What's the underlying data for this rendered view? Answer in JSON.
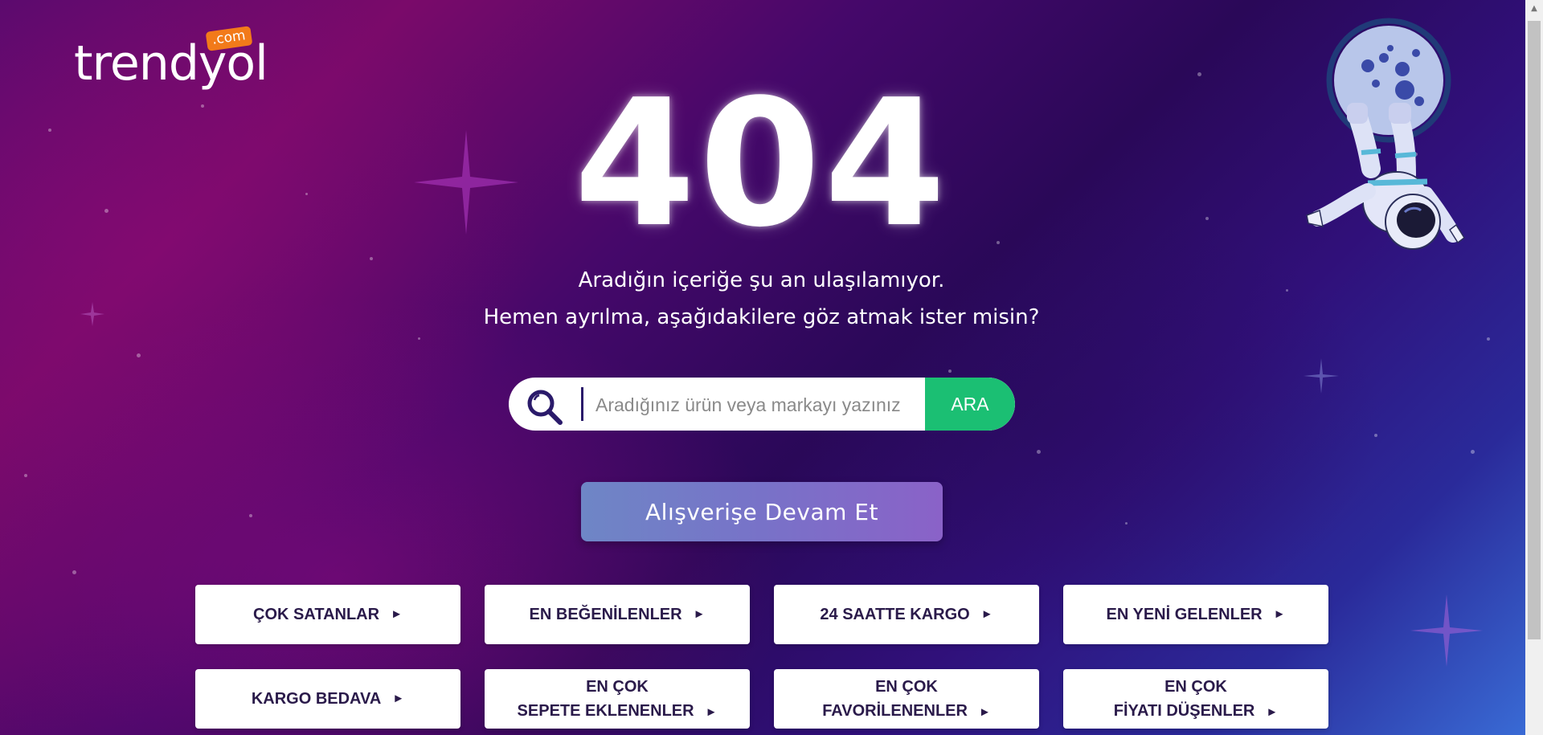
{
  "brand": {
    "name": "trendyol",
    "tld": ".com",
    "tld_color": "#f27a1a"
  },
  "error": {
    "code": "404",
    "line1": "Aradığın içeriğe şu an ulaşılamıyor.",
    "line2": "Hemen ayrılma, aşağıdakilere göz atmak ister misin?"
  },
  "search": {
    "placeholder": "Aradığınız ürün veya markayı yazınız",
    "value": "",
    "button_label": "ARA",
    "button_color": "#1bbf73",
    "icon": "search-icon"
  },
  "continue_button": {
    "label": "Alışverişe Devam Et"
  },
  "categories": [
    {
      "label": "ÇOK SATANLAR",
      "arrow": "►"
    },
    {
      "label": "EN BEĞENİLENLER",
      "arrow": "►"
    },
    {
      "label": "24 SAATTE KARGO",
      "arrow": "►"
    },
    {
      "label": "EN YENİ GELENLER",
      "arrow": "►"
    },
    {
      "label": "KARGO BEDAVA",
      "arrow": "►"
    },
    {
      "line1": "EN ÇOK",
      "line2": "SEPETE EKLENENLER",
      "arrow": "►"
    },
    {
      "line1": "EN ÇOK",
      "line2": "FAVORİLENENLER",
      "arrow": "►"
    },
    {
      "line1": "EN ÇOK",
      "line2": "FİYATI DÜŞENLER",
      "arrow": "►"
    }
  ],
  "illustration": {
    "icon": "astronaut-moon-icon"
  },
  "colors": {
    "background_start": "#5a0a6e",
    "background_end": "#3a6ed8",
    "text_dark": "#2a1a4a"
  }
}
